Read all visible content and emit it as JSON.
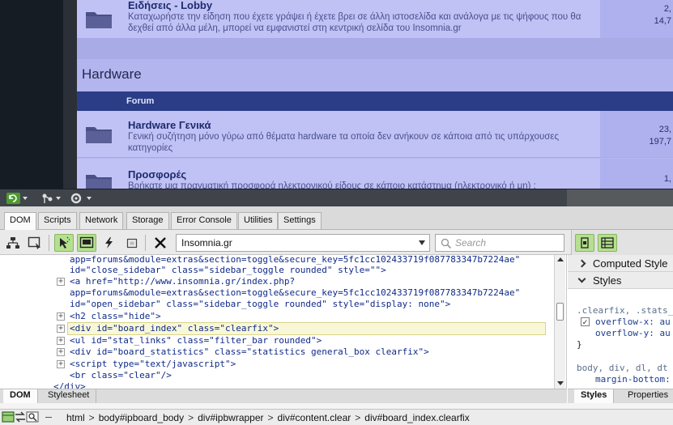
{
  "webpage": {
    "forums": [
      {
        "title": "Ειδήσεις - Lobby",
        "description": "Καταχωρήστε την είδηση που έχετε γράψει ή έχετε βρει σε άλλη ιστοσελίδα και ανάλογα με τις ψήφους που θα δεχθεί από άλλα μέλη, μπορεί να εμφανιστεί στη κεντρική σελίδα του Insomnia.gr",
        "stat_1": "2,",
        "stat_2": "14,7"
      },
      {
        "title": "Hardware Γενικά",
        "description": "Γενική συζήτηση μόνο γύρω από θέματα hardware τα οποία δεν ανήκουν σε κάποια από τις υπάρχουσες κατηγορίες",
        "stat_1": "23,",
        "stat_2": "197,7"
      },
      {
        "title": "Προσφορές",
        "description": "Βρήκατε μια πραγματική προσφορά ηλεκτρονικού είδους σε κάποιο κατάστημα (ηλεκτρονικό ή μη) ;",
        "stat_1": "1,",
        "stat_2": ""
      }
    ],
    "section_title": "Hardware",
    "column_header": "Forum"
  },
  "tabs": [
    "DOM",
    "Scripts",
    "Network",
    "Storage",
    "Error Console",
    "Utilities",
    "Settings"
  ],
  "toolbar": {
    "document_select": "Insomnia.gr",
    "search_placeholder": "Search"
  },
  "dom_source": {
    "line_0": "app=forums&module=extras&section=toggle&secure_key=5fc1cc102433719f087783347b7224ae\"",
    "line_1": "id=\"close_sidebar\" class=\"sidebar_toggle rounded\" style=\"\">",
    "line_2": "<a href=\"http://www.insomnia.gr/index.php?",
    "line_3": "app=forums&module=extras&section=toggle&secure_key=5fc1cc102433719f087783347b7224ae\"",
    "line_4": "id=\"open_sidebar\" class=\"sidebar_toggle rounded\" style=\"display: none\">",
    "line_5": "<h2 class=\"hide\">",
    "line_6": "<div id=\"board_index\" class=\"clearfix\">",
    "line_7": "<ul id=\"stat_links\" class=\"filter_bar rounded\">",
    "line_8": "<div id=\"board_statistics\" class=\"statistics general_box clearfix\">",
    "line_9": "<script type=\"text/javascript\">",
    "line_10": "<br class=\"clear\"/>",
    "line_11": "</div>"
  },
  "styles_panel": {
    "computed_label": "Computed Style",
    "styles_label": "Styles",
    "rule1_selector": ".clearfix, .stats_",
    "rule1_prop1": "overflow-x: au",
    "rule1_prop2": "overflow-y: au",
    "rule1_close": "}",
    "rule2_selector": "body, div, dl, dt",
    "rule2_prop1": "margin-bottom:"
  },
  "dom_subtabs": [
    "DOM",
    "Stylesheet"
  ],
  "style_subtabs": [
    "Styles",
    "Properties"
  ],
  "breadcrumb": [
    "html",
    "body#ipboard_body",
    "div#ipbwrapper",
    "div#content.clear",
    "div#board_index.clearfix"
  ],
  "colors": {
    "forum_bg": "#c0c2f5",
    "forum_header_blue": "#2a3d86",
    "selected_line": "#f8f7d8"
  }
}
